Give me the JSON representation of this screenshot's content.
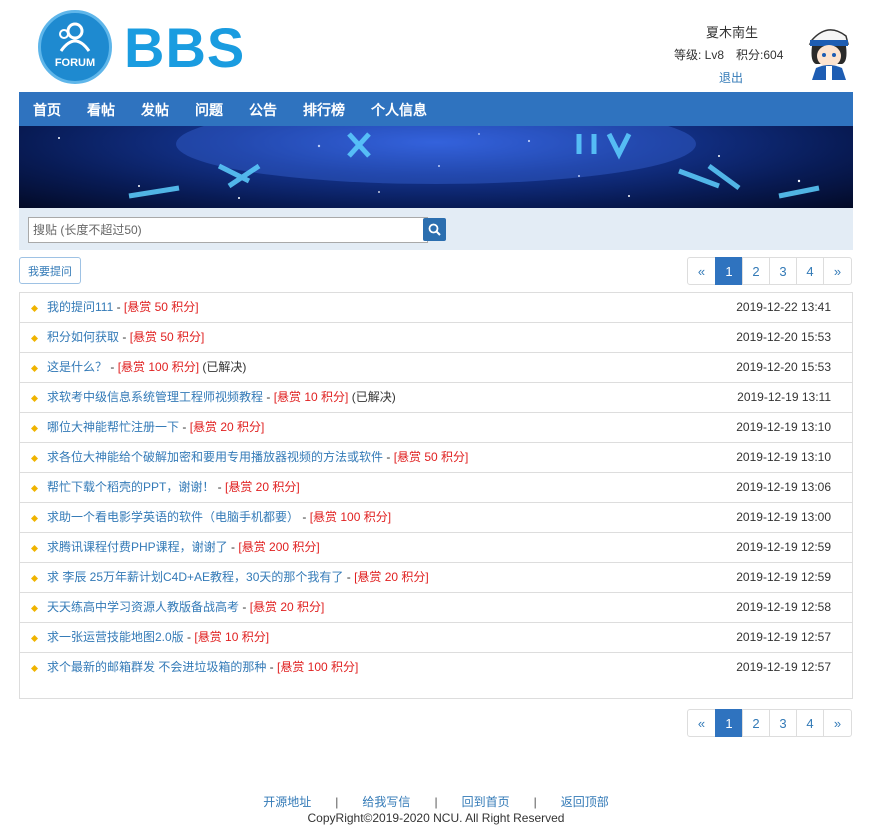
{
  "header": {
    "logo_badge": "FORUM",
    "logo_text": "BBS",
    "user_name": "夏木南生",
    "user_level": "等级: Lv8",
    "user_points": "积分:604",
    "logout": "退出"
  },
  "nav": {
    "items": [
      "首页",
      "看帖",
      "发帖",
      "问题",
      "公告",
      "排行榜",
      "个人信息"
    ]
  },
  "search": {
    "placeholder": "搜贴 (长度不超过50)",
    "value": ""
  },
  "ask_button": "我要提问",
  "pagination": {
    "prev": "«",
    "next": "»",
    "pages": [
      "1",
      "2",
      "3",
      "4"
    ],
    "active": "1"
  },
  "questions": [
    {
      "title": "我的提问111",
      "reward": "[悬赏 50 积分]",
      "status": "",
      "time": "2019-12-22 13:41"
    },
    {
      "title": "积分如何获取",
      "reward": "[悬赏 50 积分]",
      "status": "",
      "time": "2019-12-20 15:53"
    },
    {
      "title": "这是什么？",
      "reward": "[悬赏 100 积分]",
      "status": "(已解决)",
      "time": "2019-12-20 15:53"
    },
    {
      "title": "求软考中级信息系统管理工程师视频教程",
      "reward": "[悬赏 10 积分]",
      "status": "(已解决)",
      "time": "2019-12-19 13:11"
    },
    {
      "title": "哪位大神能帮忙注册一下",
      "reward": "[悬赏 20 积分]",
      "status": "",
      "time": "2019-12-19 13:10"
    },
    {
      "title": "求各位大神能给个破解加密和要用专用播放器视频的方法或软件",
      "reward": "[悬赏 50 积分]",
      "status": "",
      "time": "2019-12-19 13:10"
    },
    {
      "title": "帮忙下载个稻壳的PPT，谢谢！",
      "reward": "[悬赏 20 积分]",
      "status": "",
      "time": "2019-12-19 13:06"
    },
    {
      "title": "求助一个看电影学英语的软件（电脑手机都要）",
      "reward": "[悬赏 100 积分]",
      "status": "",
      "time": "2019-12-19 13:00"
    },
    {
      "title": "求腾讯课程付费PHP课程，谢谢了",
      "reward": "[悬赏 200 积分]",
      "status": "",
      "time": "2019-12-19 12:59"
    },
    {
      "title": "求 李辰 25万年薪计划C4D+AE教程，30天的那个我有了",
      "reward": "[悬赏 20 积分]",
      "status": "",
      "time": "2019-12-19 12:59"
    },
    {
      "title": "天天练高中学习资源人教版备战高考",
      "reward": "[悬赏 20 积分]",
      "status": "",
      "time": "2019-12-19 12:58"
    },
    {
      "title": "求一张运营技能地图2.0版",
      "reward": "[悬赏 10 积分]",
      "status": "",
      "time": "2019-12-19 12:57"
    },
    {
      "title": "求个最新的邮箱群发 不会进垃圾箱的那种",
      "reward": "[悬赏 100 积分]",
      "status": "",
      "time": "2019-12-19 12:57"
    }
  ],
  "footer": {
    "links": [
      "开源地址",
      "给我写信",
      "回到首页",
      "返回顶部"
    ],
    "separator": "|",
    "copyright": "CopyRight©2019-2020 NCU. All Right Reserved"
  }
}
